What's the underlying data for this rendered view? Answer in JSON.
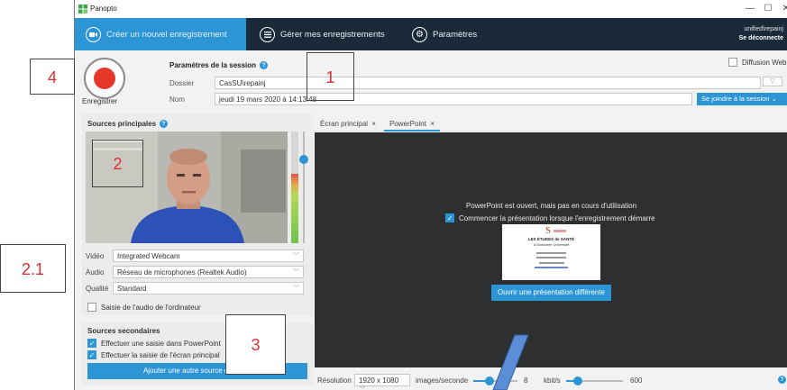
{
  "window": {
    "title": "Panopto",
    "min_glyph": "—",
    "max_glyph": "☐",
    "close_glyph": "✕"
  },
  "nav": {
    "tabs": [
      {
        "label": "Créer un nouvel enregistrement",
        "icon": "camera-icon"
      },
      {
        "label": "Gérer mes enregistrements",
        "icon": "list-icon"
      },
      {
        "label": "Paramètres",
        "icon": "gear-icon"
      }
    ],
    "user": "unified\\repainj",
    "logout": "Se déconnecte"
  },
  "record": {
    "label": "Enregistrer"
  },
  "session": {
    "title": "Paramètres de la session",
    "help": "?",
    "folder_label": "Dossier",
    "folder_value": "CasSU\\repainj",
    "name_label": "Nom",
    "name_value": "jeudi 19 mars 2020 à 14:13:48",
    "broadcast_label": "Diffusion Web",
    "join_button": "Se joindre à la session"
  },
  "sources": {
    "title": "Sources principales",
    "video_label": "Vidéo",
    "video_value": "Integrated Webcam",
    "audio_label": "Audio",
    "audio_value": "Réseau de microphones (Realtek Audio)",
    "quality_label": "Qualité",
    "quality_value": "Standard",
    "system_audio": "Saisie de l'audio de l'ordinateur",
    "audio_level": 0.62
  },
  "secondary": {
    "title": "Sources secondaires",
    "items": [
      {
        "label": "Effectuer une saisie dans PowerPoint",
        "checked": true
      },
      {
        "label": "Effectuer la saisie de l'écran principal",
        "checked": true
      }
    ],
    "add_button": "Ajouter une autre source de vidéo"
  },
  "preview": {
    "tabs": [
      {
        "label": "Écran principal",
        "close": "×"
      },
      {
        "label": "PowerPoint",
        "close": "×",
        "active": true
      }
    ],
    "message": "PowerPoint est ouvert, mais pas en cours d'utilisation",
    "auto_start": "Commencer la présentation lorsque l'enregistrement démarre",
    "slide": {
      "logo": "S",
      "line1": "LES ÉTUDES de SANTÉ",
      "line2": "à Sorbonne Université"
    },
    "open_button": "Ouvrir une présentation différente"
  },
  "bottom": {
    "resolution_label": "Résolution",
    "resolution_value": "1920 x 1080",
    "fps_label": "images/seconde",
    "fps_value": "8",
    "kbps_label": "kbit/s",
    "kbps_value": "600"
  },
  "annotations": [
    "4",
    "1",
    "2",
    "2.1",
    "3"
  ],
  "colors": {
    "accent": "#2b95d6",
    "nav_bg": "#1b2a38",
    "record_red": "#e53829",
    "preview_bg": "#2e2f30",
    "annotation_red": "#d63031"
  }
}
